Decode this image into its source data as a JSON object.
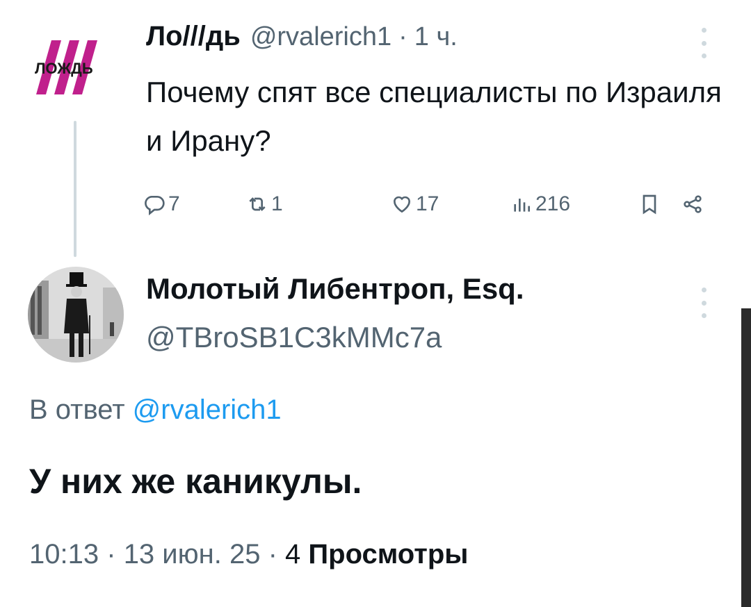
{
  "parent": {
    "logo_text": "ЛОЖДЬ",
    "name": "Ло///дь",
    "handle": "@rvalerich1",
    "separator": "·",
    "time": "1 ч.",
    "text": "Почему спят все специалисты по Израиля и Ирану?",
    "actions": {
      "replies": "7",
      "reposts": "1",
      "likes": "17",
      "views": "216"
    },
    "colors": {
      "logo_stripes": "#c0208c"
    }
  },
  "reply": {
    "name": "Молотый Либентроп, Esq.",
    "handle": "@TBroSB1C3kMMc7a",
    "reply_prefix": "В ответ",
    "reply_to": "@rvalerich1",
    "text": "У них же каникулы.",
    "time": "10:13",
    "date": "13 июн. 25",
    "separator": "·",
    "views_count": "4",
    "views_label": "Просмотры"
  },
  "icons": [
    "more-icon",
    "reply-icon",
    "repost-icon",
    "like-icon",
    "views-icon",
    "bookmark-icon",
    "share-icon"
  ],
  "colors": {
    "text": "#0f1419",
    "muted": "#536471",
    "link": "#1d9bf0",
    "thread_line": "#cfd9de"
  }
}
